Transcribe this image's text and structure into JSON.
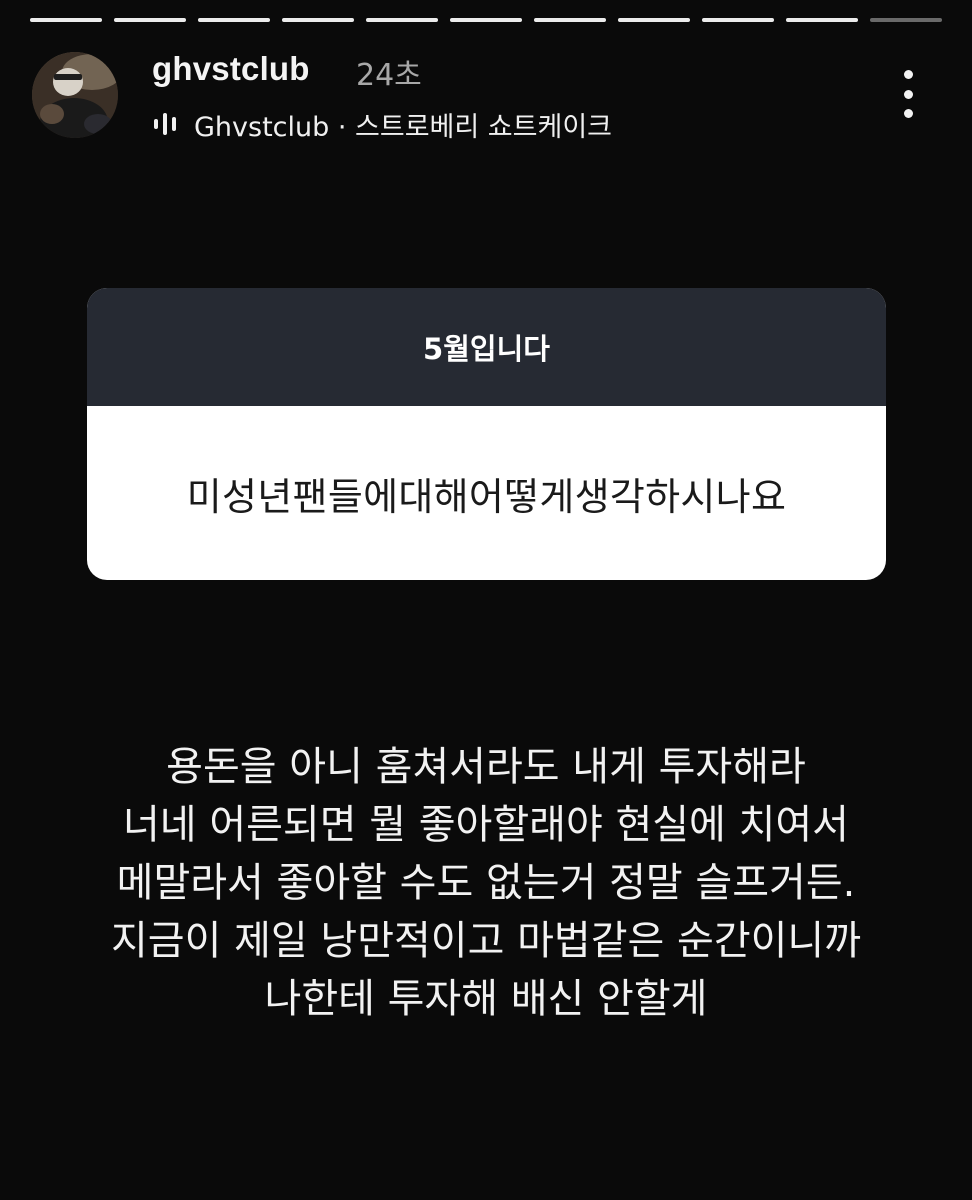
{
  "story": {
    "segment_count": 11,
    "current_segment": 11
  },
  "header": {
    "username": "ghvstclub",
    "timestamp": "24초",
    "music": {
      "icon": "audio-bars-icon",
      "text": "Ghvstclub · 스트로베리 쇼트케이크"
    },
    "more_icon": "more-vertical-icon"
  },
  "question_card": {
    "header_text": "5월입니다",
    "question_text": "미성년팬들에대해어떻게생각하시나요"
  },
  "answer": {
    "lines": [
      "용돈을 아니 훔쳐서라도 내게 투자해라",
      "너네 어른되면 뭘 좋아할래야 현실에 치여서",
      "메말라서 좋아할 수도 없는거 정말 슬프거든.",
      "지금이 제일 낭만적이고 마법같은 순간이니까",
      "나한테 투자해 배신 안할게"
    ]
  },
  "colors": {
    "background": "#0a0a0a",
    "card_header": "#262a33",
    "card_body": "#ffffff",
    "progress_active": "#ececec",
    "progress_inactive": "#6a6a6a"
  }
}
